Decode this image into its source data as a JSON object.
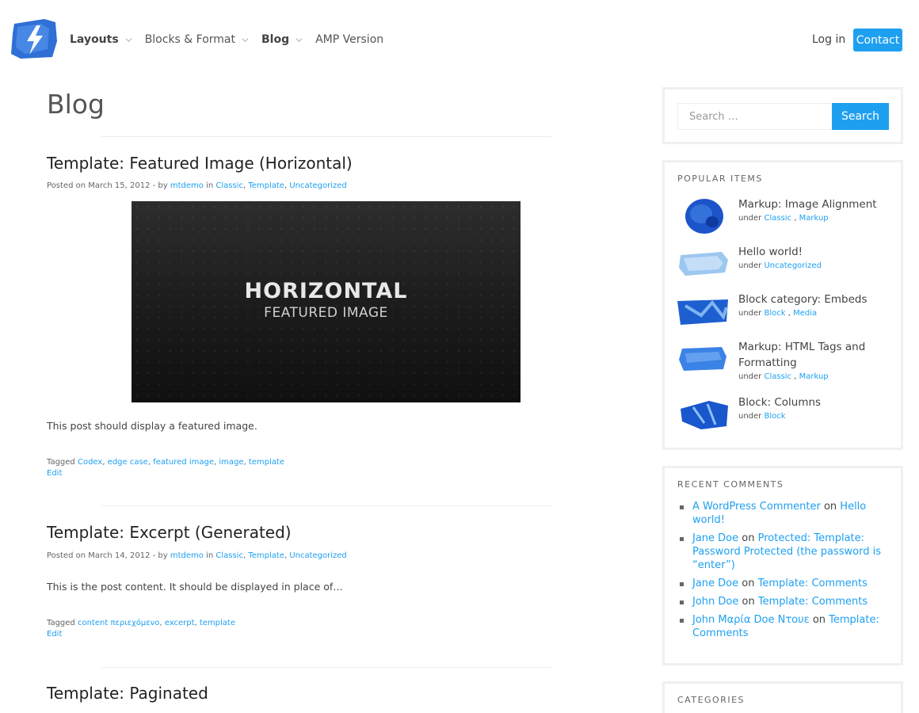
{
  "header": {
    "nav": [
      {
        "label": "Layouts",
        "bold": true,
        "dropdown": true
      },
      {
        "label": "Blocks & Format",
        "bold": false,
        "dropdown": true
      },
      {
        "label": "Blog",
        "bold": true,
        "dropdown": true
      },
      {
        "label": "AMP Version",
        "bold": false,
        "dropdown": false
      }
    ],
    "login": "Log in",
    "contact": "Contact",
    "accent_color": "#1ea0f1"
  },
  "main": {
    "page_title": "Blog",
    "posts": [
      {
        "title": "Template: Featured Image (Horizontal)",
        "meta_prefix": "Posted on March 15, 2012 - by ",
        "author": "mtdemo",
        "meta_in": " in ",
        "categories": [
          "Classic",
          "Template",
          "Uncategorized"
        ],
        "featured_image": {
          "line1": "HORIZONTAL",
          "line2": "FEATURED IMAGE"
        },
        "excerpt": "This post should display a featured image.",
        "tags_label": "Tagged ",
        "tags": [
          "Codex",
          "edge case",
          "featured image",
          "image",
          "template"
        ],
        "edit": "Edit"
      },
      {
        "title": "Template: Excerpt (Generated)",
        "meta_prefix": "Posted on March 14, 2012 - by ",
        "author": "mtdemo",
        "meta_in": " in ",
        "categories": [
          "Classic",
          "Template",
          "Uncategorized"
        ],
        "excerpt": "This is the post content. It should be displayed in place of…",
        "tags_label": "Tagged ",
        "tags": [
          "content περιεχόμενο",
          "excerpt",
          "template"
        ],
        "edit": "Edit"
      },
      {
        "title": "Template: Paginated"
      }
    ]
  },
  "sidebar": {
    "search": {
      "placeholder": "Search …",
      "button": "Search"
    },
    "popular": {
      "title": "POPULAR ITEMS",
      "under_label": "under ",
      "items": [
        {
          "title": "Markup: Image Alignment",
          "cats": [
            "Classic",
            "Markup"
          ]
        },
        {
          "title": "Hello world!",
          "cats": [
            "Uncategorized"
          ]
        },
        {
          "title": "Block category: Embeds",
          "cats": [
            "Block",
            "Media"
          ]
        },
        {
          "title": "Markup: HTML Tags and Formatting",
          "cats": [
            "Classic",
            "Markup"
          ]
        },
        {
          "title": "Block: Columns",
          "cats": [
            "Block"
          ]
        }
      ]
    },
    "recent_comments": {
      "title": "RECENT COMMENTS",
      "on_label": " on ",
      "items": [
        {
          "author": "A WordPress Commenter",
          "post": "Hello world!"
        },
        {
          "author": "Jane Doe",
          "post": "Protected: Template: Password Protected (the password is “enter”)"
        },
        {
          "author": "Jane Doe",
          "post": "Template: Comments"
        },
        {
          "author": "John Doe",
          "post": "Template: Comments"
        },
        {
          "author": "John Μαρία Doe Ντουε",
          "post": "Template: Comments"
        }
      ]
    },
    "categories": {
      "title": "CATEGORIES"
    }
  }
}
